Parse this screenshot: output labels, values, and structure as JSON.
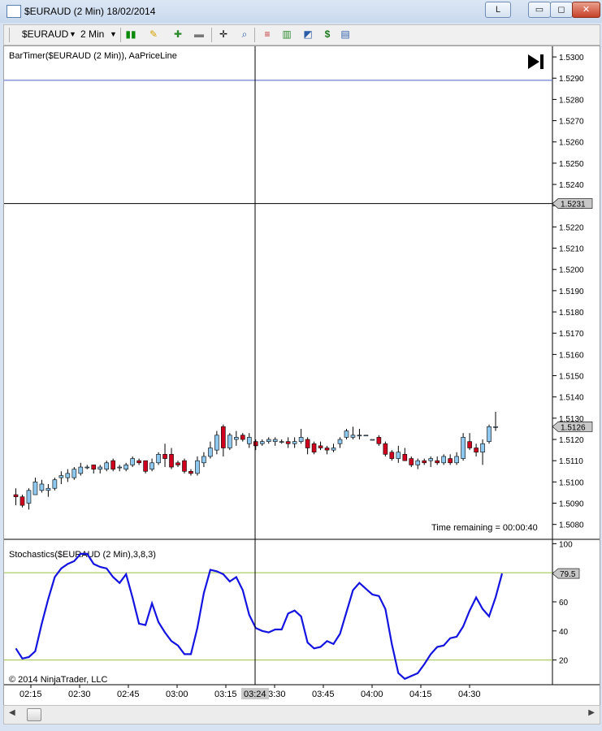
{
  "window": {
    "title": "$EURAUD (2 Min)  18/02/2014",
    "btn_l": "L",
    "btn_min": "▭",
    "btn_max": "◻",
    "btn_close": "✕"
  },
  "toolbar": {
    "instrument": "$EURAUD",
    "interval": "2 Min"
  },
  "chart_data": [
    {
      "type": "candlestick",
      "title": "BarTimer($EURAUD (2 Min)), AaPriceLine",
      "ylim": [
        1.5073,
        1.5305
      ],
      "yticks": [
        "1.5300",
        "1.5290",
        "1.5280",
        "1.5270",
        "1.5260",
        "1.5250",
        "1.5240",
        "1.5230",
        "1.5220",
        "1.5210",
        "1.5200",
        "1.5190",
        "1.5180",
        "1.5170",
        "1.5160",
        "1.5150",
        "1.5140",
        "1.5130",
        "1.5120",
        "1.5110",
        "1.5100",
        "1.5090",
        "1.5080"
      ],
      "price_line": 1.5231,
      "price_line_label": "1.5231",
      "last_price_label": "1.5126",
      "blue_line": 1.5289,
      "time_remaining": "Time remaining = 00:00:40",
      "candles": [
        [
          1.5094,
          1.5097,
          1.5089,
          1.5093
        ],
        [
          1.5093,
          1.5094,
          1.5088,
          1.5089
        ],
        [
          1.509,
          1.5097,
          1.5087,
          1.5096
        ],
        [
          1.5094,
          1.5102,
          1.5094,
          1.51
        ],
        [
          1.5096,
          1.5101,
          1.5095,
          1.5099
        ],
        [
          1.5096,
          1.5099,
          1.5093,
          1.5097
        ],
        [
          1.5097,
          1.5102,
          1.5096,
          1.5101
        ],
        [
          1.5102,
          1.5105,
          1.5099,
          1.5103
        ],
        [
          1.5102,
          1.5106,
          1.51,
          1.5104
        ],
        [
          1.5102,
          1.5107,
          1.5101,
          1.5106
        ],
        [
          1.5104,
          1.5109,
          1.5103,
          1.5107
        ],
        [
          1.5107,
          1.5108,
          1.5106,
          1.5107
        ],
        [
          1.5108,
          1.5108,
          1.5104,
          1.5106
        ],
        [
          1.5106,
          1.5108,
          1.5104,
          1.5107
        ],
        [
          1.5106,
          1.511,
          1.5105,
          1.5109
        ],
        [
          1.511,
          1.5111,
          1.5105,
          1.5106
        ],
        [
          1.5107,
          1.5108,
          1.5105,
          1.5107
        ],
        [
          1.5106,
          1.5109,
          1.5105,
          1.5108
        ],
        [
          1.5108,
          1.5112,
          1.5107,
          1.5111
        ],
        [
          1.511,
          1.5111,
          1.5108,
          1.5109
        ],
        [
          1.511,
          1.511,
          1.5104,
          1.5105
        ],
        [
          1.5106,
          1.5111,
          1.5105,
          1.5109
        ],
        [
          1.5109,
          1.5114,
          1.5108,
          1.5113
        ],
        [
          1.5113,
          1.5118,
          1.5107,
          1.5111
        ],
        [
          1.5113,
          1.5116,
          1.5106,
          1.5107
        ],
        [
          1.5109,
          1.511,
          1.5107,
          1.5108
        ],
        [
          1.511,
          1.5111,
          1.5104,
          1.5105
        ],
        [
          1.5105,
          1.5106,
          1.5103,
          1.5104
        ],
        [
          1.5104,
          1.5112,
          1.5103,
          1.511
        ],
        [
          1.5109,
          1.5114,
          1.5107,
          1.5112
        ],
        [
          1.5112,
          1.5119,
          1.5111,
          1.5116
        ],
        [
          1.5115,
          1.5124,
          1.5113,
          1.5122
        ],
        [
          1.5126,
          1.5127,
          1.5112,
          1.5116
        ],
        [
          1.5116,
          1.5123,
          1.5115,
          1.5122
        ],
        [
          1.512,
          1.5124,
          1.5117,
          1.5121
        ],
        [
          1.5122,
          1.5123,
          1.5119,
          1.512
        ],
        [
          1.5118,
          1.5123,
          1.5116,
          1.5121
        ],
        [
          1.5119,
          1.512,
          1.5115,
          1.5117
        ],
        [
          1.5118,
          1.512,
          1.5117,
          1.5119
        ],
        [
          1.5119,
          1.5121,
          1.5118,
          1.512
        ],
        [
          1.5119,
          1.5121,
          1.5117,
          1.512
        ],
        [
          1.5119,
          1.512,
          1.5118,
          1.5119
        ],
        [
          1.5119,
          1.5121,
          1.5116,
          1.5118
        ],
        [
          1.5118,
          1.5121,
          1.5116,
          1.5119
        ],
        [
          1.5119,
          1.5125,
          1.5118,
          1.5121
        ],
        [
          1.512,
          1.5121,
          1.5113,
          1.5116
        ],
        [
          1.5118,
          1.5119,
          1.5113,
          1.5114
        ],
        [
          1.5117,
          1.5119,
          1.5115,
          1.5116
        ],
        [
          1.5116,
          1.5117,
          1.5113,
          1.5115
        ],
        [
          1.5115,
          1.5118,
          1.5114,
          1.5116
        ],
        [
          1.5118,
          1.5121,
          1.5116,
          1.512
        ],
        [
          1.5121,
          1.5125,
          1.512,
          1.5124
        ],
        [
          1.5121,
          1.5126,
          1.512,
          1.5122
        ],
        [
          1.5122,
          1.5125,
          1.512,
          1.5122
        ],
        [
          1.5122,
          1.5122,
          1.5122,
          1.5122
        ],
        [
          1.512,
          1.512,
          1.512,
          1.512
        ],
        [
          1.5121,
          1.5122,
          1.5117,
          1.5118
        ],
        [
          1.5118,
          1.5119,
          1.5112,
          1.5113
        ],
        [
          1.5114,
          1.5115,
          1.511,
          1.5111
        ],
        [
          1.5111,
          1.5117,
          1.5109,
          1.5114
        ],
        [
          1.5113,
          1.5116,
          1.511,
          1.511
        ],
        [
          1.5111,
          1.5112,
          1.5107,
          1.5108
        ],
        [
          1.5108,
          1.5111,
          1.5106,
          1.511
        ],
        [
          1.511,
          1.5111,
          1.5108,
          1.5109
        ],
        [
          1.511,
          1.5112,
          1.5107,
          1.5111
        ],
        [
          1.511,
          1.5112,
          1.5108,
          1.5109
        ],
        [
          1.5109,
          1.5113,
          1.5108,
          1.5112
        ],
        [
          1.5111,
          1.5113,
          1.5108,
          1.5109
        ],
        [
          1.5109,
          1.5114,
          1.5108,
          1.5112
        ],
        [
          1.5111,
          1.5123,
          1.511,
          1.5121
        ],
        [
          1.5119,
          1.5123,
          1.5115,
          1.5116
        ],
        [
          1.5116,
          1.5118,
          1.5112,
          1.5114
        ],
        [
          1.5114,
          1.512,
          1.5108,
          1.5118
        ],
        [
          1.5119,
          1.5127,
          1.5118,
          1.5126
        ],
        [
          1.5126,
          1.5133,
          1.5124,
          1.5126
        ]
      ]
    },
    {
      "type": "line",
      "title": "Stochastics($EURAUD (2 Min),3,8,3)",
      "ylim": [
        3,
        103
      ],
      "yticks": [
        "100",
        "80",
        "60",
        "40",
        "20"
      ],
      "levels": [
        80,
        20
      ],
      "last_value_label": "79.5",
      "series": [
        {
          "values": [
            28,
            21,
            22,
            26,
            45,
            62,
            77,
            83,
            86,
            88,
            93,
            93,
            86,
            84,
            83,
            77,
            73,
            79,
            63,
            45,
            44,
            59,
            46,
            39,
            33,
            30,
            24,
            24,
            42,
            66,
            82,
            81,
            79,
            74,
            77,
            68,
            51,
            42,
            40,
            39,
            41,
            41,
            52,
            54,
            50,
            32,
            28,
            29,
            33,
            31,
            38,
            53,
            68,
            73,
            69,
            65,
            64,
            55,
            31,
            11,
            7,
            9,
            11,
            17,
            24,
            29,
            30,
            35,
            36,
            43,
            54,
            63,
            55,
            50,
            63,
            79.5
          ]
        }
      ]
    }
  ],
  "xaxis": {
    "ticks": [
      "02:15",
      "02:30",
      "02:45",
      "03:00",
      "03:15",
      "03:30",
      "03:45",
      "04:00",
      "04:15",
      "04:30"
    ],
    "cursor_label": "03:24"
  },
  "copyright": "© 2014 NinjaTrader, LLC"
}
